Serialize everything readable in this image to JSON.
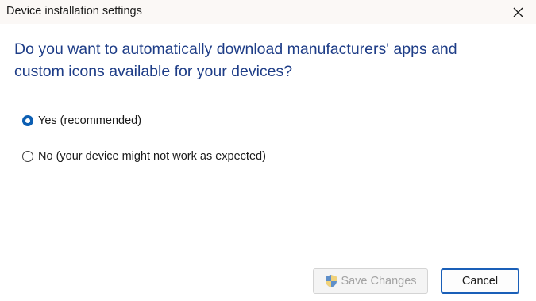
{
  "window": {
    "title": "Device installation settings",
    "close_icon": "close-icon"
  },
  "prompt": {
    "question": "Do you want to automatically download manufacturers' apps and custom icons available for your devices?"
  },
  "options": [
    {
      "label": "Yes (recommended)",
      "selected": true
    },
    {
      "label": "No (your device might not work as expected)",
      "selected": false
    }
  ],
  "buttons": {
    "save_label": "Save Changes",
    "save_enabled": false,
    "save_icon": "uac-shield-icon",
    "cancel_label": "Cancel"
  },
  "colors": {
    "heading": "#1e3d87",
    "accent": "#0c5fb3",
    "titlebar_bg": "#fbf8f6"
  }
}
